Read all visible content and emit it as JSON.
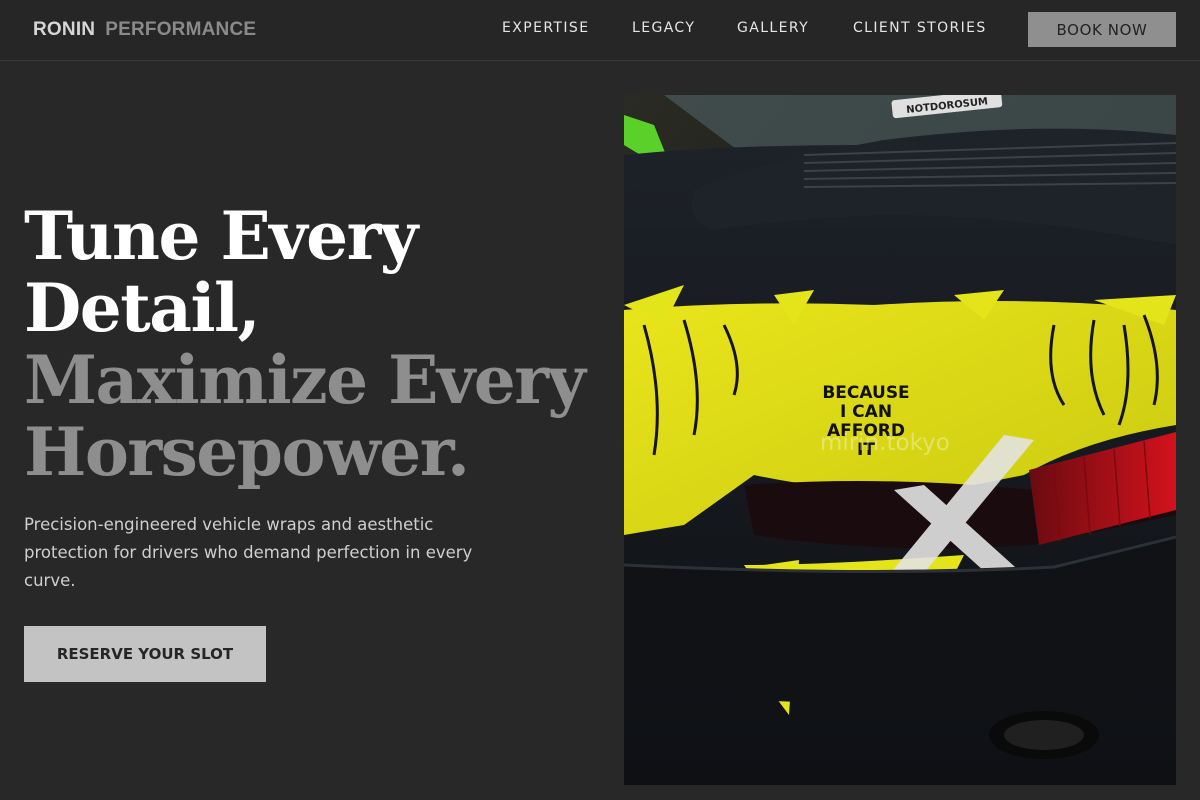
{
  "brand": {
    "name_primary": "RONIN",
    "name_secondary": "PERFORMANCE"
  },
  "nav": {
    "items": [
      {
        "label": "EXPERTISE"
      },
      {
        "label": "LEGACY"
      },
      {
        "label": "GALLERY"
      },
      {
        "label": "CLIENT STORIES"
      }
    ],
    "cta_label": "BOOK NOW"
  },
  "hero": {
    "headline_lines": [
      {
        "text": "Tune Every",
        "tone": "light"
      },
      {
        "text": "Detail,",
        "tone": "light"
      },
      {
        "text": "Maximize Every",
        "tone": "muted"
      },
      {
        "text": "Horsepower.",
        "tone": "muted"
      }
    ],
    "subtitle": "Precision-engineered vehicle wraps and aesthetic protection for drivers who demand perfection in every curve.",
    "cta_label": "RESERVE YOUR SLOT",
    "image": {
      "sticker_lines": [
        "BECAUSE",
        "I CAN",
        "AFFORD",
        "IT"
      ],
      "plate_text": "NOTDOROSUM",
      "watermark": "mirin.tokyo"
    }
  },
  "colors": {
    "background": "#282828",
    "accent_yellow": "#e4e41a",
    "book_button": "#8f8f8f",
    "cta_button": "#c3c3c3",
    "muted_text": "#8e8e8e"
  }
}
